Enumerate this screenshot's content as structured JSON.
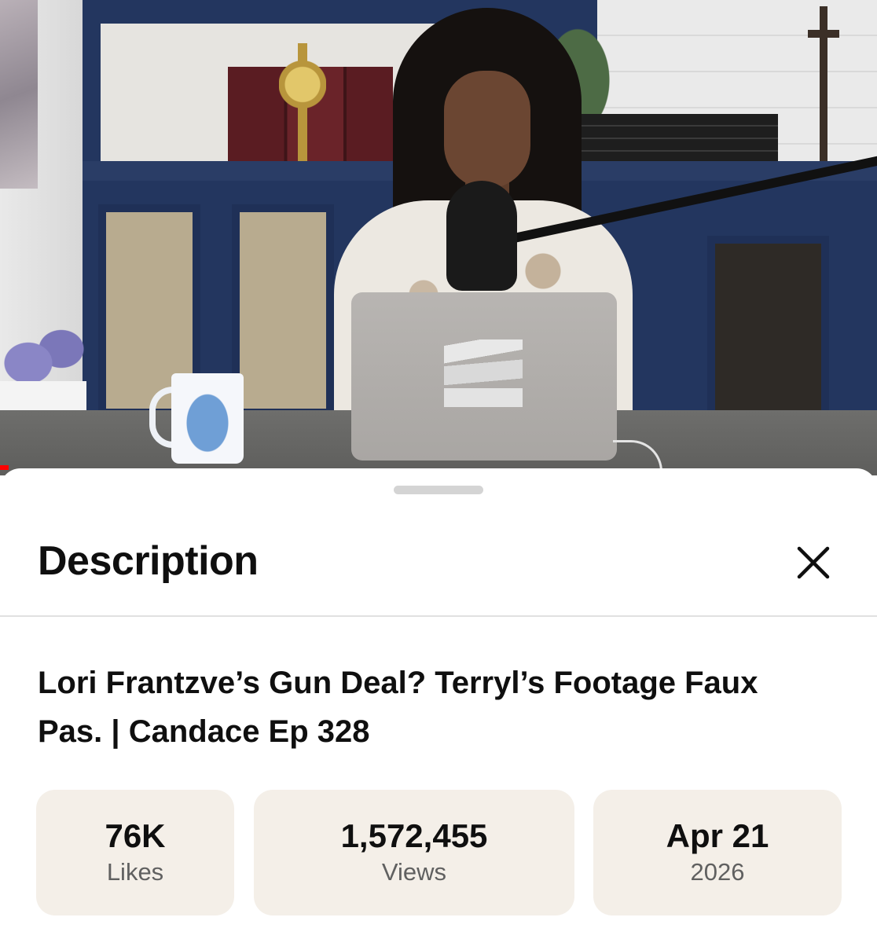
{
  "video": {
    "progress_fraction": 0.01,
    "accent_color": "#ff0000"
  },
  "sheet": {
    "title": "Description",
    "close_icon": "close-icon",
    "video_title": "Lori Frantzve’s Gun Deal? Terryl’s Footage Faux Pas. | Candace Ep 328"
  },
  "stats": {
    "likes": {
      "value": "76K",
      "label": "Likes"
    },
    "views": {
      "value": "1,572,455",
      "label": "Views"
    },
    "date": {
      "value": "Apr 21",
      "label": "2026"
    }
  }
}
